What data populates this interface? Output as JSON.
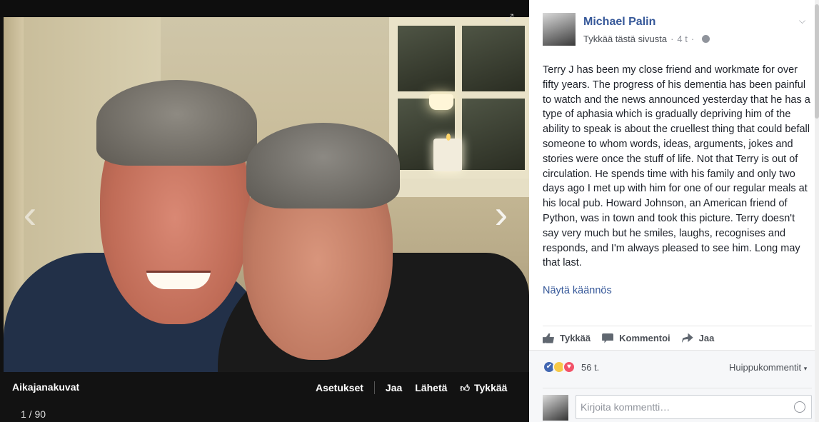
{
  "viewer": {
    "album_title": "Aikajanakuvat",
    "counter": "1 / 90",
    "actions": {
      "settings": "Asetukset",
      "share": "Jaa",
      "send": "Lähetä",
      "like": "Tykkää"
    },
    "icons": {
      "prev": "chevron-left-icon",
      "next": "chevron-right-icon",
      "expand": "expand-icon"
    }
  },
  "post": {
    "author": "Michael Palin",
    "like_page": "Tykkää tästä sivusta",
    "time": "4 t",
    "text": "Terry J has been my close friend and workmate for over fifty years. The progress of his dementia has been painful to watch and the news announced yesterday that he has a type of aphasia which is gradually depriving him of the ability to speak is about the cruellest thing that could befall someone to whom words, ideas, arguments, jokes and stories were once the stuff of life. Not that Terry is out of circulation. He spends time with his family and only two days ago I met up with him for one of our regular meals at his local pub. Howard Johnson, an American friend of Python, was in town and took this picture. Terry doesn't say very much but he smiles, laughs, recognises and responds, and I'm always pleased to see him. Long may that last.",
    "translate_link": "Näytä käännös",
    "actions": {
      "like": "Tykkää",
      "comment": "Kommentoi",
      "share": "Jaa"
    },
    "reactions": {
      "count": "56 t.",
      "types": [
        "like",
        "sad",
        "love"
      ]
    },
    "top_comments": "Huippukommentit",
    "comment_placeholder": "Kirjoita kommentti…"
  },
  "colors": {
    "link": "#365899",
    "like_blue": "#4267b2",
    "love_red": "#f25268",
    "sad_yellow": "#f7c948"
  }
}
